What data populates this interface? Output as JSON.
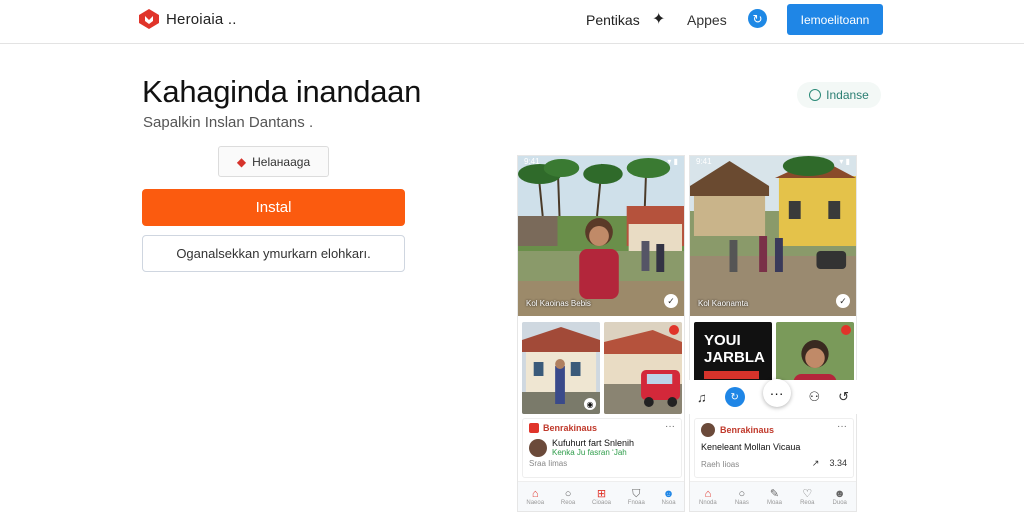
{
  "nav": {
    "brand": "Heroiaia ..",
    "link1": "Pentikas",
    "link2": "Appes",
    "cta": "Iemoelitoann",
    "brand_color": "#e0342a",
    "accent": "#1f86e6"
  },
  "hero": {
    "title": "Kahagindа inandaan",
    "subtitle": "Sapalkin Inslan Dantans .",
    "badge": "Helaнaaga",
    "install_label": "Instal",
    "secondary_label": "Oganalsekkan ymurkarn elohkarı.",
    "install_color": "#fb5b0f"
  },
  "pill": {
    "label": "Indanse"
  },
  "screens": [
    {
      "status_time": "9:41",
      "big_caption": "Kol Kaoinas Bebis",
      "card": {
        "header": "Benrakinaus",
        "title": "Kufuhurt fart Snlenih",
        "meta": "Kenka Ju fasran ʻJah",
        "meta2": "Sraa Iimas"
      },
      "nav": [
        "Naeoa",
        "Reoa",
        "Cioaoa",
        "Fnoaa",
        "Nsoa"
      ]
    },
    {
      "status_time": "9:41",
      "big_caption": "Kol Kaonamta",
      "poster": "YOUI JARBLA",
      "card": {
        "header": "Benrakinaus",
        "title": "Keneleant Mollan Vicaua",
        "meta": "Raeh Iioas",
        "meta2": "3.34"
      },
      "nav": [
        "Nnoda",
        "Naas",
        "Moaa",
        "Reoa",
        "Duoa"
      ]
    }
  ]
}
